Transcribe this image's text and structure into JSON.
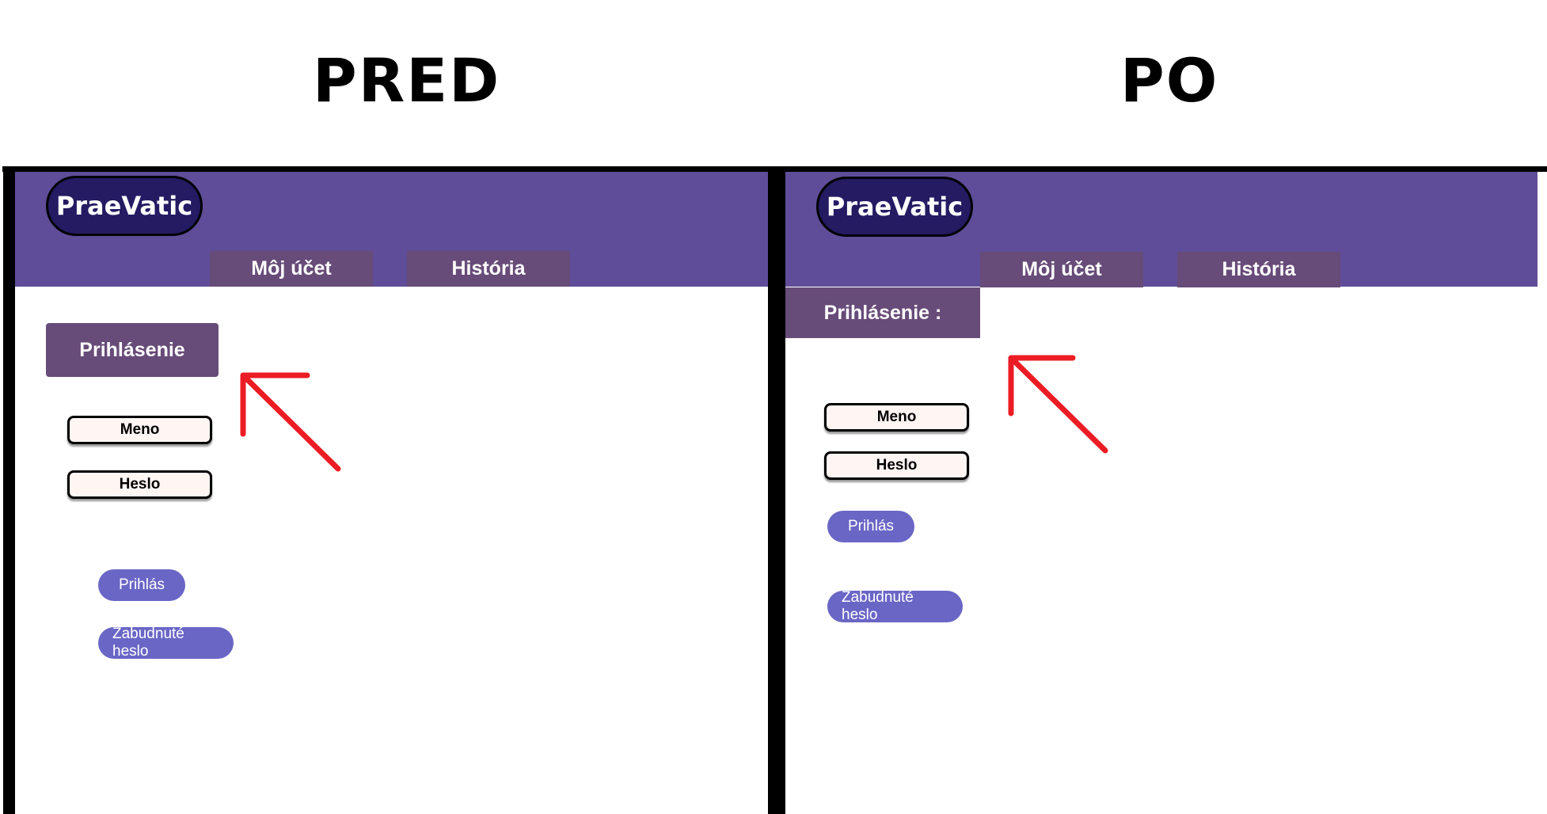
{
  "headings": {
    "before": "PRED",
    "after": "PO"
  },
  "before": {
    "logo": "PraeVatic",
    "tabs": [
      "Môj účet",
      "História"
    ],
    "login_title": "Prihlásenie",
    "fields": {
      "name": "Meno",
      "password": "Heslo"
    },
    "buttons": {
      "login": "Prihlás",
      "forgot": "Zabudnuté heslo"
    }
  },
  "after": {
    "logo": "PraeVatic",
    "tabs": [
      "Môj účet",
      "História"
    ],
    "login_title": "Prihlásenie :",
    "fields": {
      "name": "Meno",
      "password": "Heslo"
    },
    "buttons": {
      "login": "Prihlás",
      "forgot": "Zabudnuté heslo"
    }
  },
  "colors": {
    "header": "#5f4d99",
    "logo": "#241b63",
    "tab": "#674b78",
    "field": "#fff6f4",
    "pill": "#6a66c6",
    "arrow": "#ec1c24"
  },
  "icons": {
    "annotation": "arrow-up-left-icon"
  }
}
